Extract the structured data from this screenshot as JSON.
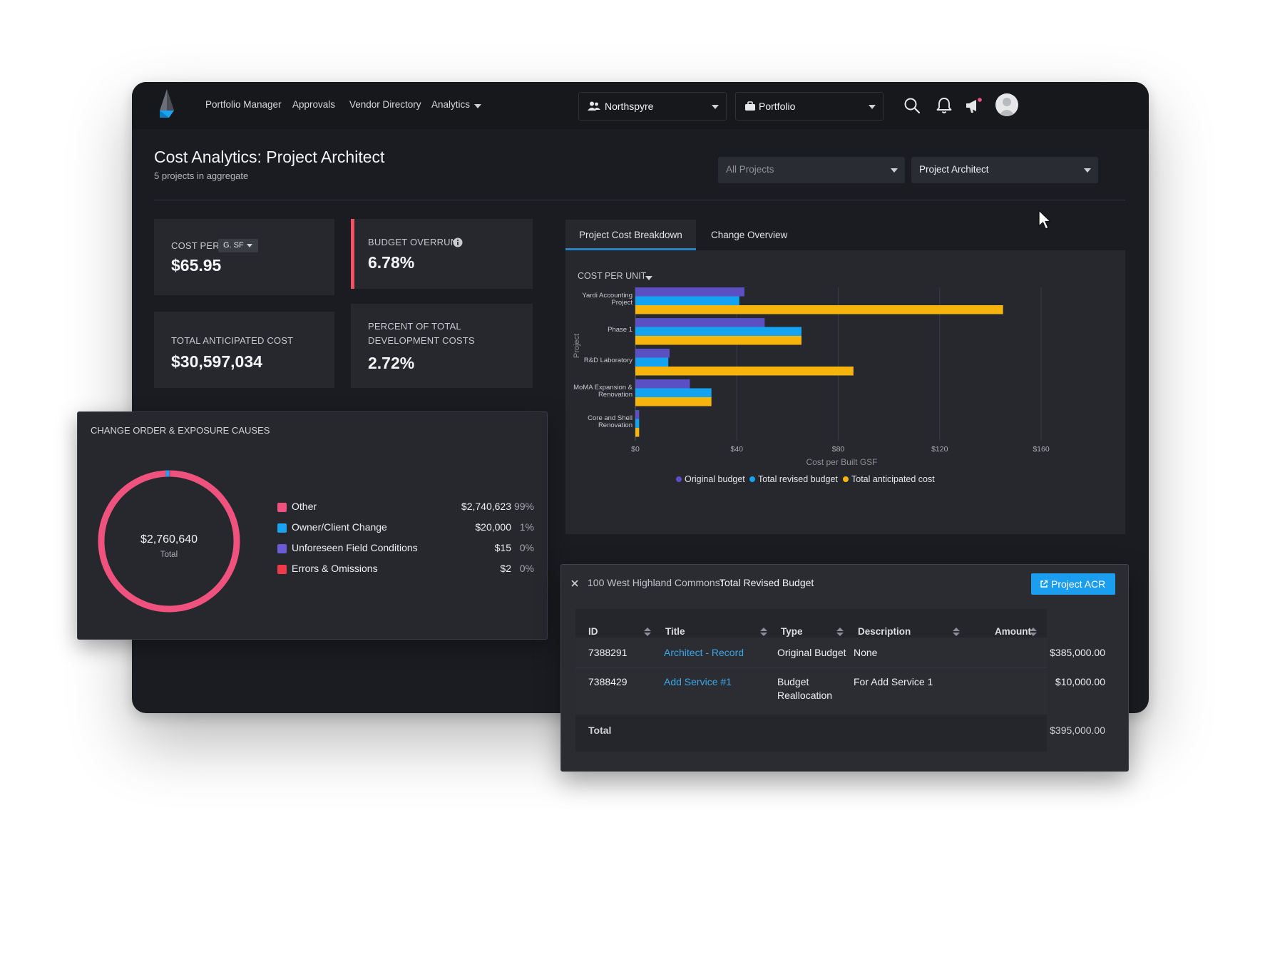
{
  "nav": {
    "links": [
      "Portfolio Manager",
      "Approvals",
      "Vendor Directory",
      "Analytics"
    ],
    "org_select": "Northspyre",
    "portfolio_select": "Portfolio",
    "icons": [
      "search-icon",
      "bell-icon",
      "megaphone-icon",
      "avatar"
    ]
  },
  "header": {
    "title": "Cost Analytics: Project Architect",
    "subtitle": "5 projects in aggregate",
    "filter_projects": "All Projects",
    "filter_vendor": "Project Architect"
  },
  "kpis": {
    "cost_per": {
      "label": "COST PER",
      "unit_select": "G. SF",
      "value": "$65.95"
    },
    "budget_overrun": {
      "label": "BUDGET OVERRUN",
      "value": "6.78%"
    },
    "total_anticipated": {
      "label": "TOTAL ANTICIPATED COST",
      "value": "$30,597,034"
    },
    "percent_total": {
      "label_line1": "PERCENT OF TOTAL",
      "label_line2": "DEVELOPMENT COSTS",
      "value": "2.72%"
    }
  },
  "tabs": [
    "Project Cost Breakdown",
    "Change Overview"
  ],
  "chart_controls": {
    "metric_select": "COST PER UNIT"
  },
  "chart_data": {
    "type": "bar",
    "orientation": "horizontal",
    "categories": [
      "Yardi Accounting Project",
      "Phase 1",
      "R&D Laboratory",
      "MoMA Expansion & Renovation",
      "Core and Shell Renovation"
    ],
    "category_lines": [
      [
        "Yardi Accounting",
        "Project"
      ],
      [
        "Phase 1"
      ],
      [
        "R&D Laboratory"
      ],
      [
        "MoMA Expansion &",
        "Renovation"
      ],
      [
        "Core and Shell",
        "Renovation"
      ]
    ],
    "series": [
      {
        "name": "Original budget",
        "color": "#5b4fc4",
        "values": [
          43,
          51,
          13.5,
          21.5,
          1.5
        ]
      },
      {
        "name": "Total revised budget",
        "color": "#14a3f0",
        "values": [
          41,
          65.5,
          13,
          30,
          1.5
        ]
      },
      {
        "name": "Total anticipated cost",
        "color": "#f6b40c",
        "values": [
          145,
          65.5,
          86,
          30,
          1.5
        ]
      }
    ],
    "xlabel": "Cost per Built GSF",
    "ylabel": "Project",
    "xlim": [
      0,
      160
    ],
    "xticks": [
      "$0",
      "$40",
      "$80",
      "$120",
      "$160"
    ],
    "xtick_values": [
      0,
      40,
      80,
      120,
      160
    ],
    "grid": true,
    "legend_position": "bottom"
  },
  "donut": {
    "title": "CHANGE ORDER & EXPOSURE CAUSES",
    "total_value": "$2,760,640",
    "total_label": "Total",
    "segments": [
      {
        "name": "Other",
        "amount": "$2,740,623",
        "pct": "99%",
        "value": 2740623,
        "color": "#f0527e"
      },
      {
        "name": "Owner/Client Change",
        "amount": "$20,000",
        "pct": "1%",
        "value": 20000,
        "color": "#1aa3f0"
      },
      {
        "name": "Unforeseen Field Conditions",
        "amount": "$15",
        "pct": "0%",
        "value": 15,
        "color": "#6b5cd6"
      },
      {
        "name": "Errors & Omissions",
        "amount": "$2",
        "pct": "0%",
        "value": 2,
        "color": "#ef3b47"
      }
    ]
  },
  "acr": {
    "project": "100 West Highland Commons:",
    "title": "Total Revised Budget",
    "button": "Project ACR",
    "columns": [
      "ID",
      "Title",
      "Type",
      "Description",
      "Amount"
    ],
    "rows": [
      {
        "id": "7388291",
        "title": "Architect - Record",
        "type": "Original Budget",
        "type_line2": "",
        "description": "None",
        "amount": "$385,000.00"
      },
      {
        "id": "7388429",
        "title": "Add Service #1",
        "type": "Budget",
        "type_line2": "Reallocation",
        "description": "For Add Service 1",
        "amount": "$10,000.00"
      }
    ],
    "total_label": "Total",
    "total_amount": "$395,000.00"
  }
}
